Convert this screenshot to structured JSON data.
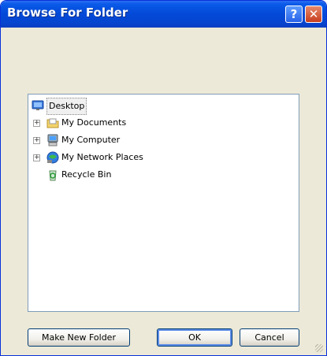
{
  "window": {
    "title": "Browse For Folder",
    "help_glyph": "?",
    "close_glyph": "✕"
  },
  "tree": {
    "root": {
      "label": "Desktop",
      "icon": "desktop-icon"
    },
    "items": [
      {
        "label": "My Documents",
        "icon": "documents-folder-icon",
        "expandable": true
      },
      {
        "label": "My Computer",
        "icon": "computer-icon",
        "expandable": true
      },
      {
        "label": "My Network Places",
        "icon": "network-places-icon",
        "expandable": true
      },
      {
        "label": "Recycle Bin",
        "icon": "recycle-bin-icon",
        "expandable": false
      }
    ],
    "expander_glyph": "+"
  },
  "buttons": {
    "make_new_folder": "Make New Folder",
    "ok": "OK",
    "cancel": "Cancel"
  },
  "colors": {
    "titlebar": "#0449d8",
    "dialog_bg": "#ece9d8",
    "close_button": "#c63d1d"
  }
}
